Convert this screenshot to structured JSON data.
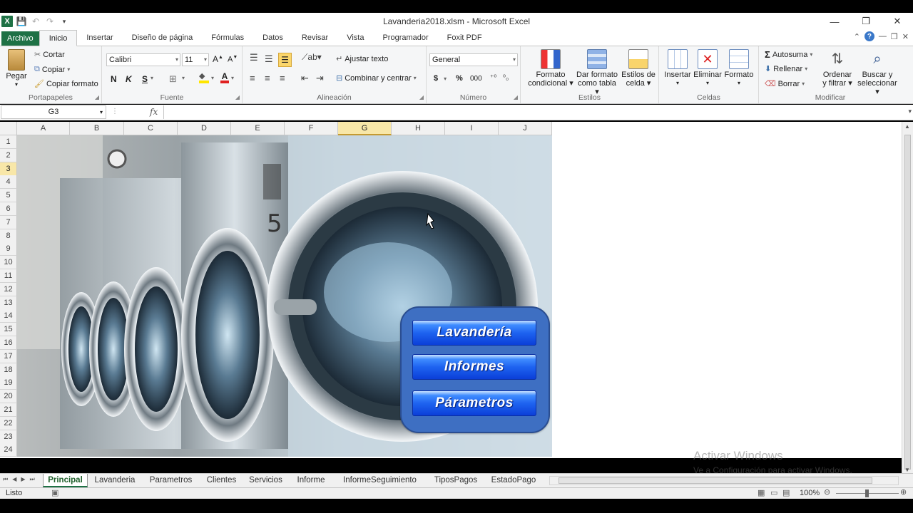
{
  "window": {
    "title": "Lavanderia2018.xlsm - Microsoft Excel",
    "minimize": "—",
    "restore": "❐",
    "close": "✕"
  },
  "ribbon_tabs": [
    "Archivo",
    "Inicio",
    "Insertar",
    "Diseño de página",
    "Fórmulas",
    "Datos",
    "Revisar",
    "Vista",
    "Programador",
    "Foxit PDF"
  ],
  "active_ribbon_tab": "Inicio",
  "clipboard": {
    "paste": "Pegar",
    "cut": "Cortar",
    "copy": "Copiar",
    "format_painter": "Copiar formato",
    "label": "Portapapeles"
  },
  "font": {
    "name": "Calibri",
    "size": "11",
    "bold": "N",
    "italic": "K",
    "underline": "S",
    "label": "Fuente"
  },
  "alignment": {
    "wrap": "Ajustar texto",
    "merge": "Combinar y centrar",
    "label": "Alineación"
  },
  "number": {
    "format": "General",
    "currency": "$",
    "percent": "%",
    "thousands": "000",
    "label": "Número"
  },
  "styles": {
    "cond": [
      "Formato",
      "condicional"
    ],
    "table": [
      "Dar formato",
      "como tabla"
    ],
    "cell": [
      "Estilos de",
      "celda"
    ],
    "label": "Estilos"
  },
  "cells": {
    "insert": "Insertar",
    "delete": "Eliminar",
    "format": "Formato",
    "label": "Celdas"
  },
  "editing": {
    "autosum": "Autosuma",
    "fill": "Rellenar",
    "clear": "Borrar",
    "sort": [
      "Ordenar",
      "y filtrar"
    ],
    "find": [
      "Buscar y",
      "seleccionar"
    ],
    "label": "Modificar"
  },
  "formula_bar": {
    "name_box": "G3",
    "fx": "fx",
    "value": ""
  },
  "columns": [
    "A",
    "B",
    "C",
    "D",
    "E",
    "F",
    "G",
    "H",
    "I",
    "J"
  ],
  "selected_column": "G",
  "rows": [
    "1",
    "2",
    "3",
    "4",
    "5",
    "6",
    "7",
    "8",
    "9",
    "10",
    "11",
    "12",
    "13",
    "14",
    "15",
    "16",
    "17",
    "18",
    "19",
    "20",
    "21",
    "22",
    "23",
    "24"
  ],
  "selected_row": "3",
  "menu_buttons": [
    "Lavandería",
    "Informes",
    "Párametros"
  ],
  "sheet_tabs": [
    "Principal",
    "Lavanderia",
    "Parametros",
    "Clientes",
    "Servicios",
    "Informe",
    "InformeSeguimiento",
    "TiposPagos",
    "EstadoPago"
  ],
  "active_sheet": "Principal",
  "status": {
    "ready": "Listo",
    "zoom": "100%"
  },
  "watermark": {
    "line1": "Activar Windows",
    "line2": "Ve a Configuración para activar Windows."
  },
  "colors": {
    "excel_green": "#1e7145",
    "menu_panel": "#3e6fc2",
    "button_blue": "#1e63f0",
    "selection": "#f8e7a8"
  }
}
